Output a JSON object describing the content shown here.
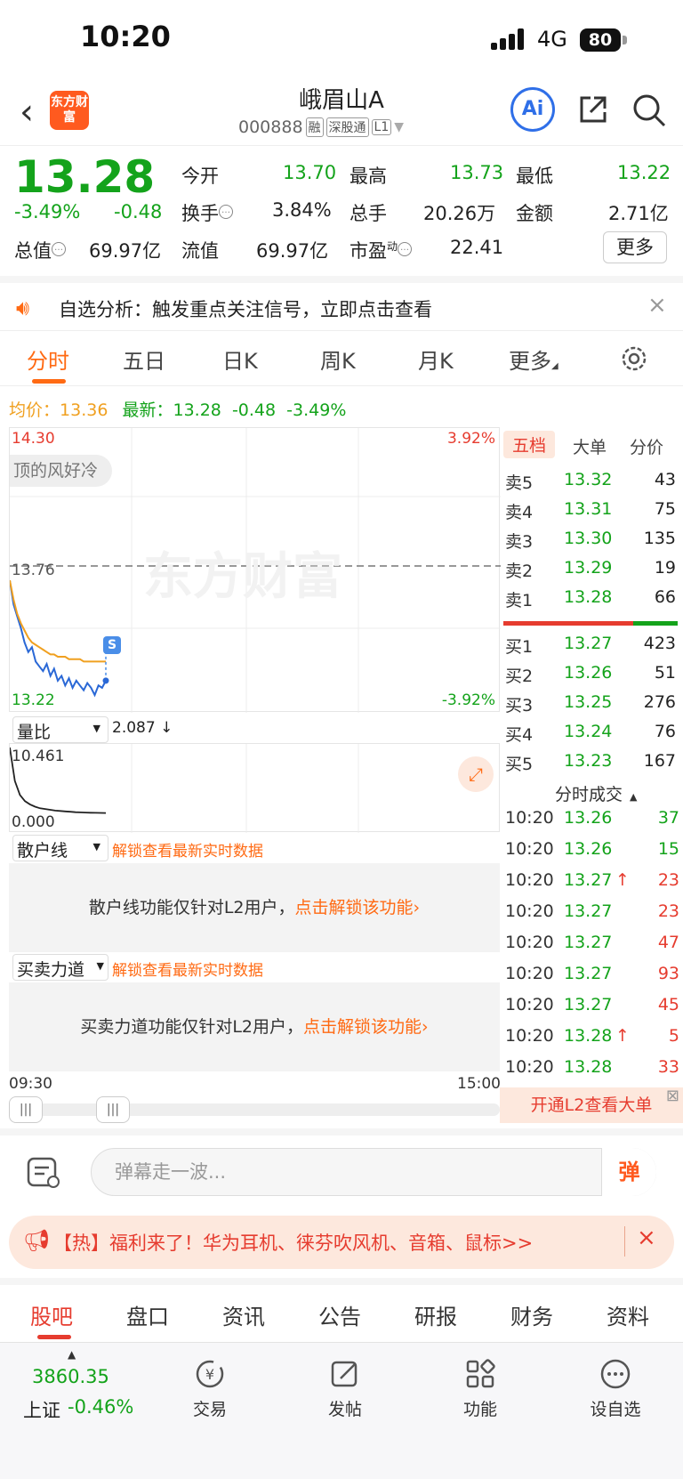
{
  "status": {
    "time": "10:20",
    "network": "4G",
    "battery": "80"
  },
  "header": {
    "title": "峨眉山A",
    "code": "000888",
    "tags": [
      "融",
      "深股通",
      "L1"
    ],
    "logo_text": "东方财富",
    "ai_label": "Ai"
  },
  "quote": {
    "price": "13.28",
    "pct_change": "-3.49%",
    "change": "-0.48",
    "open_label": "今开",
    "open": "13.70",
    "high_label": "最高",
    "high": "13.73",
    "low_label": "最低",
    "low": "13.22",
    "turnover_label": "换手",
    "turnover": "3.84%",
    "volume_label": "总手",
    "volume": "20.26万",
    "amount_label": "金额",
    "amount": "2.71亿",
    "mktcap_label": "总值",
    "mktcap": "69.97亿",
    "float_label": "流值",
    "float_cap": "69.97亿",
    "pe_label": "市盈",
    "pe_sup": "动",
    "pe": "22.41",
    "more": "更多"
  },
  "notice": {
    "text": "自选分析：触发重点关注信号，立即点击查看"
  },
  "chart_tabs": [
    "分时",
    "五日",
    "日K",
    "周K",
    "月K",
    "更多"
  ],
  "avg": {
    "avg_label": "均价：",
    "avg_value": "13.36",
    "latest_label": "最新：",
    "latest_value": "13.28",
    "latest_change": "-0.48",
    "latest_pct": "-3.49%"
  },
  "chart_data": {
    "type": "line",
    "y_labels": {
      "top": "14.30",
      "bottom": "13.22",
      "ref": "13.76",
      "top_pct": "3.92%",
      "bottom_pct": "-3.92%"
    },
    "ylim": [
      13.22,
      14.3
    ],
    "reference": 13.76,
    "x_labels": {
      "start": "09:30",
      "end": "15:00"
    },
    "series": [
      {
        "values": [
          13.7,
          13.6,
          13.55,
          13.5,
          13.44,
          13.4,
          13.42,
          13.36,
          13.34,
          13.32,
          13.35,
          13.3,
          13.33,
          13.28,
          13.3,
          13.26,
          13.29,
          13.25,
          13.28,
          13.26,
          13.24,
          13.27,
          13.25,
          13.22,
          13.26,
          13.25,
          13.28
        ]
      },
      {
        "values": [
          13.7,
          13.62,
          13.56,
          13.52,
          13.49,
          13.46,
          13.44,
          13.43,
          13.42,
          13.41,
          13.4,
          13.39,
          13.39,
          13.38,
          13.38,
          13.38,
          13.37,
          13.37,
          13.37,
          13.37,
          13.36,
          13.36,
          13.36,
          13.36,
          13.36,
          13.36,
          13.36
        ]
      }
    ],
    "watermark": "东方财富",
    "danmu": "顶的风好冷",
    "marker": "S"
  },
  "volume_ratio": {
    "selector": "量比",
    "value": "2.087 ↓",
    "top": "10.461",
    "bottom": "0.000",
    "values": [
      10.46,
      6.2,
      4.4,
      3.6,
      3.2,
      2.9,
      2.7,
      2.6,
      2.5,
      2.4,
      2.35,
      2.3,
      2.25,
      2.2,
      2.17,
      2.15,
      2.13,
      2.11,
      2.1,
      2.09
    ]
  },
  "retail_line": {
    "selector": "散户线",
    "lock": "解锁查看最新实时数据",
    "msg": "散户线功能仅针对L2用户，",
    "link": "点击解锁该功能›"
  },
  "buy_sell": {
    "selector": "买卖力道",
    "lock": "解锁查看最新实时数据",
    "msg": "买卖力道功能仅针对L2用户，",
    "link": "点击解锁该功能›"
  },
  "book_tabs": [
    "五档",
    "大单",
    "分价"
  ],
  "asks": [
    {
      "label": "卖5",
      "price": "13.32",
      "vol": "43"
    },
    {
      "label": "卖4",
      "price": "13.31",
      "vol": "75"
    },
    {
      "label": "卖3",
      "price": "13.30",
      "vol": "135"
    },
    {
      "label": "卖2",
      "price": "13.29",
      "vol": "19"
    },
    {
      "label": "卖1",
      "price": "13.28",
      "vol": "66"
    }
  ],
  "bids": [
    {
      "label": "买1",
      "price": "13.27",
      "vol": "423"
    },
    {
      "label": "买2",
      "price": "13.26",
      "vol": "51"
    },
    {
      "label": "买3",
      "price": "13.25",
      "vol": "276"
    },
    {
      "label": "买4",
      "price": "13.24",
      "vol": "76"
    },
    {
      "label": "买5",
      "price": "13.23",
      "vol": "167"
    }
  ],
  "trades_title": "分时成交",
  "trades": [
    {
      "time": "10:20",
      "price": "13.26",
      "vol": "37",
      "dir": ""
    },
    {
      "time": "10:20",
      "price": "13.26",
      "vol": "15",
      "dir": ""
    },
    {
      "time": "10:20",
      "price": "13.27",
      "vol": "23",
      "dir": "↑"
    },
    {
      "time": "10:20",
      "price": "13.27",
      "vol": "23",
      "dir": ""
    },
    {
      "time": "10:20",
      "price": "13.27",
      "vol": "47",
      "dir": ""
    },
    {
      "time": "10:20",
      "price": "13.27",
      "vol": "93",
      "dir": ""
    },
    {
      "time": "10:20",
      "price": "13.27",
      "vol": "45",
      "dir": ""
    },
    {
      "time": "10:20",
      "price": "13.28",
      "vol": "5",
      "dir": "↑"
    },
    {
      "time": "10:20",
      "price": "13.28",
      "vol": "33",
      "dir": ""
    }
  ],
  "l2_banner": "开通L2查看大单",
  "comment": {
    "placeholder": "弹幕走一波...",
    "danmu_btn": "弹"
  },
  "promo": {
    "text": "【热】福利来了！华为耳机、徕芬吹风机、音箱、鼠标>>"
  },
  "section_tabs": [
    "股吧",
    "盘口",
    "资讯",
    "公告",
    "研报",
    "财务",
    "资料"
  ],
  "bottom": {
    "index_value": "3860.35",
    "index_name": "上证",
    "index_change": "-0.46%",
    "nav": [
      "交易",
      "发帖",
      "功能",
      "设自选"
    ]
  }
}
